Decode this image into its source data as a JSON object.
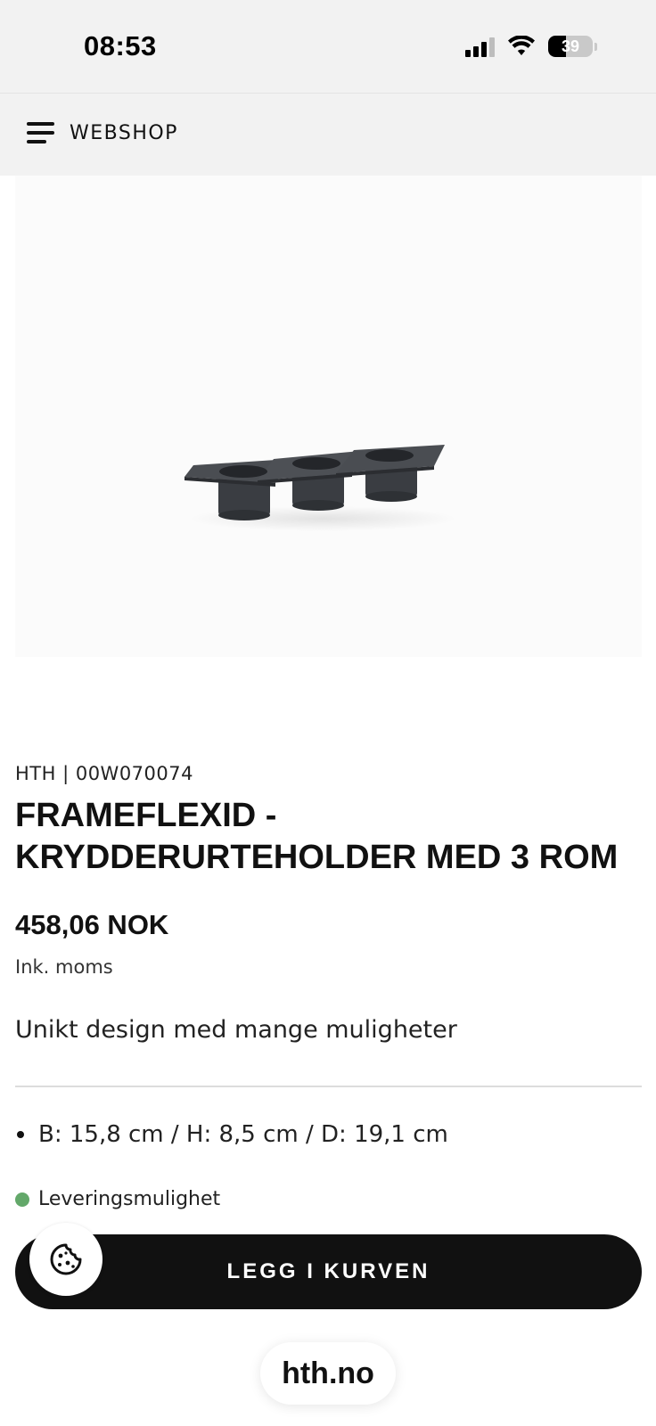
{
  "status_bar": {
    "time": "08:53",
    "battery_percent": "39",
    "battery_level": 0.39
  },
  "nav": {
    "label": "WEBSHOP"
  },
  "product": {
    "brand_sku": "HTH | 00W070074",
    "title_line1": "FRAMEFLEXID -",
    "title_line2": "KRYDDERURTEHOLDER MED 3 ROM",
    "price": "458,06 NOK",
    "vat_note": "Ink. moms",
    "tagline": "Unikt design med mange muligheter",
    "dimensions": "B: 15,8 cm / H: 8,5 cm / D: 19,1 cm",
    "delivery": "Leveringsmulighet",
    "image_icon": "herb-holder-product-image"
  },
  "actions": {
    "add_to_cart": "LEGG I KURVEN"
  },
  "browser": {
    "url": "hth.no"
  },
  "colors": {
    "accent": "#111111",
    "delivery_status": "#63a86a"
  }
}
